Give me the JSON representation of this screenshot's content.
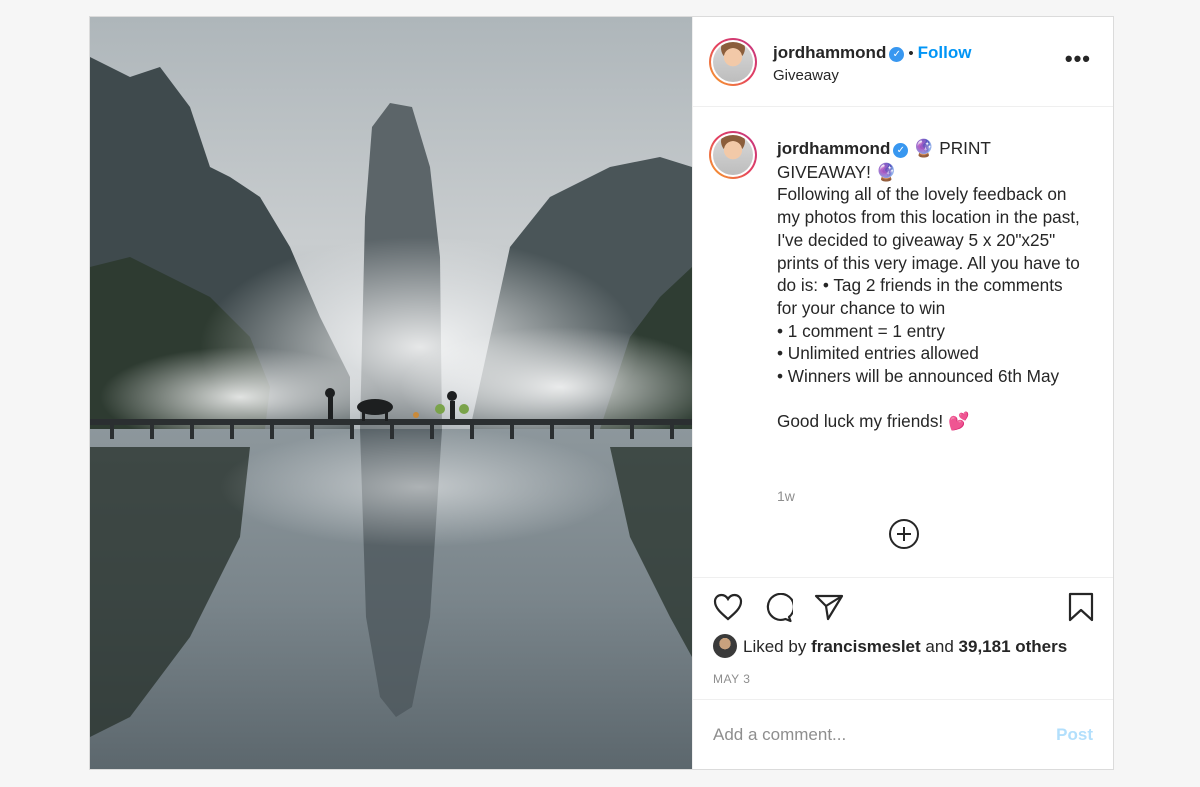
{
  "post": {
    "photo_alt": "Misty mountain lake with bridge",
    "header": {
      "username": "jordhammond",
      "separator": "•",
      "follow_label": "Follow",
      "location": "Giveaway",
      "more_label": "•••"
    },
    "caption": {
      "username": "jordhammond",
      "text": " 🔮 PRINT GIVEAWAY! 🔮\nFollowing all of the lovely feedback on my photos from this location in the past, I've decided to giveaway 5 x 20\"x25\" prints of this very image. All you have to do is: • Tag 2 friends in the comments for your chance to win\n• 1 comment = 1 entry\n• Unlimited entries allowed\n• Winners will be announced 6th May\n\nGood luck my friends! 💕"
    },
    "caption_time": "1w",
    "likes": {
      "prefix": "Liked by",
      "user": "francismeslet",
      "conjunction": "and",
      "others": "39,181 others"
    },
    "date": "MAY 3",
    "comment": {
      "placeholder": "Add a comment...",
      "post_label": "Post"
    },
    "icons": [
      "heart-icon",
      "comment-icon",
      "share-icon",
      "bookmark-icon",
      "load-more-icon",
      "verified-icon"
    ],
    "colors": {
      "accent": "#0095f6",
      "post_disabled": "#b2dffc",
      "muted": "#8e8e8e",
      "verified": "#3897f0"
    }
  }
}
